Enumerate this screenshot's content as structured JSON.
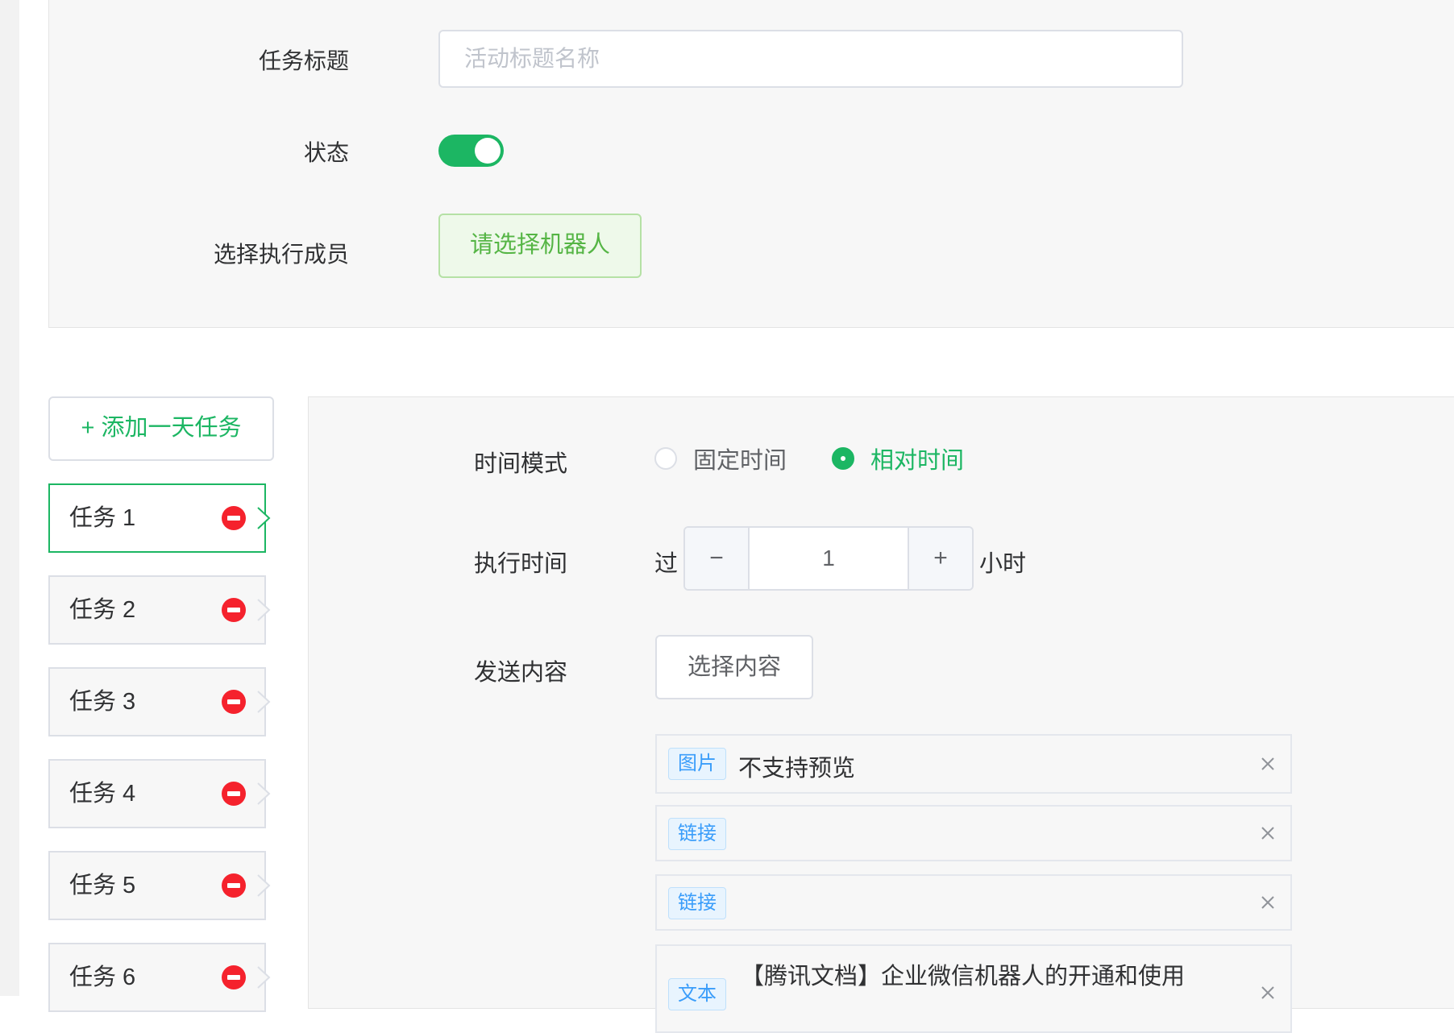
{
  "form": {
    "title_label": "任务标题",
    "title_placeholder": "活动标题名称",
    "status_label": "状态",
    "status_on": true,
    "members_label": "选择执行成员",
    "select_robot_label": "请选择机器人"
  },
  "tasks": {
    "add_day_label": "+ 添加一天任务",
    "items": [
      {
        "label": "任务 1",
        "active": true
      },
      {
        "label": "任务 2",
        "active": false
      },
      {
        "label": "任务 3",
        "active": false
      },
      {
        "label": "任务 4",
        "active": false
      },
      {
        "label": "任务 5",
        "active": false
      },
      {
        "label": "任务 6",
        "active": false
      }
    ]
  },
  "detail": {
    "time_mode_label": "时间模式",
    "time_modes": [
      {
        "label": "固定时间",
        "checked": false
      },
      {
        "label": "相对时间",
        "checked": true
      }
    ],
    "exec_time_label": "执行时间",
    "exec_prefix": "过",
    "exec_value": "1",
    "exec_minus": "−",
    "exec_plus": "+",
    "exec_suffix": "小时",
    "send_content_label": "发送内容",
    "select_content_label": "选择内容",
    "contents": [
      {
        "tag": "图片",
        "text": "不支持预览"
      },
      {
        "tag": "链接",
        "text": ""
      },
      {
        "tag": "链接",
        "text": ""
      },
      {
        "tag": "文本",
        "text": "【腾讯文档】企业微信机器人的开通和使用"
      }
    ]
  },
  "colors": {
    "primary_green": "#1cb663",
    "danger_red": "#f5222d",
    "tag_blue": "#3a9dfa"
  },
  "icons": {
    "delete": "minus-circle-icon",
    "close": "close-icon",
    "arrow": "chevron-right-icon"
  }
}
